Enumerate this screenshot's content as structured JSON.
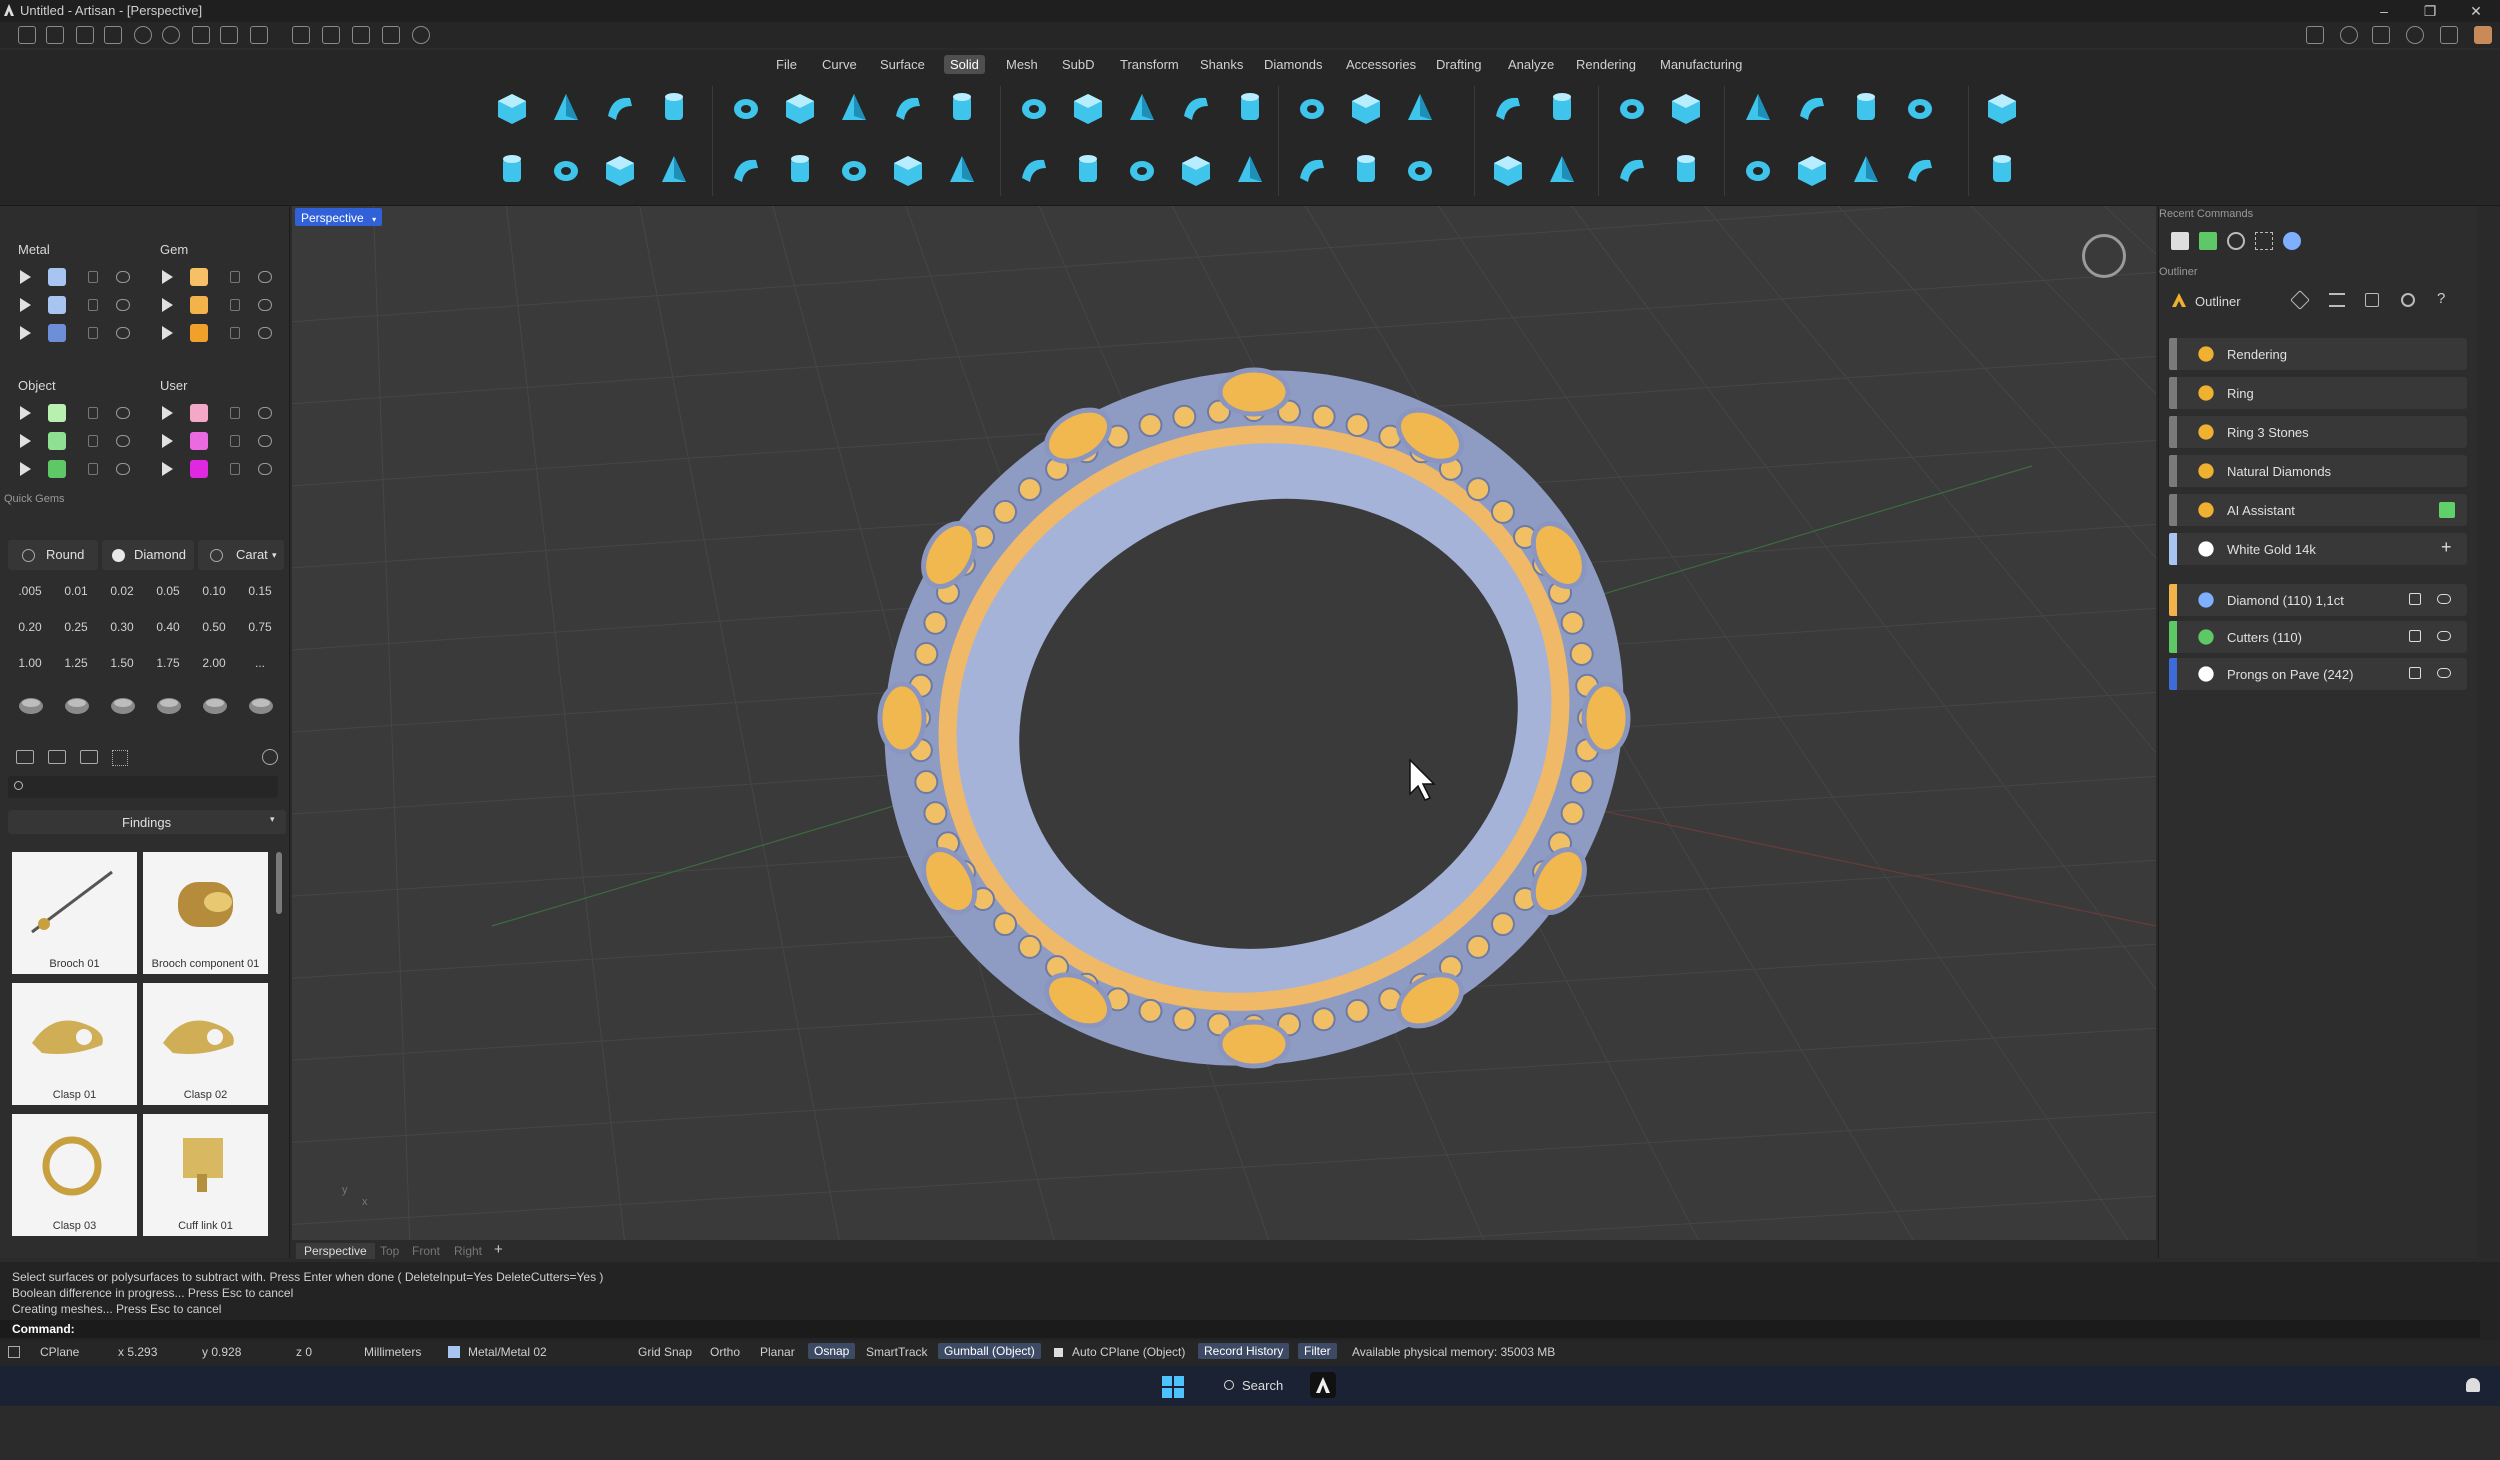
{
  "window": {
    "title": "Untitled - Artisan - [Perspective]",
    "controls": [
      "–",
      "❐",
      "✕"
    ]
  },
  "menu": {
    "items": [
      "File",
      "Curve",
      "Surface",
      "Solid",
      "Mesh",
      "SubD",
      "Transform",
      "Shanks",
      "Diamonds",
      "Accessories",
      "Drafting",
      "Analyze",
      "Rendering",
      "Manufacturing"
    ],
    "active": "Solid"
  },
  "layers": {
    "metal_title": "Metal",
    "gem_title": "Gem",
    "object_title": "Object",
    "user_title": "User",
    "metal_colors": [
      "#a8c4f0",
      "#a8c4f0",
      "#6d8fd8"
    ],
    "gem_colors": [
      "#f6c066",
      "#f3b24a",
      "#efa12c"
    ],
    "object_colors": [
      "#b8f0b0",
      "#8fe090",
      "#5ec866"
    ],
    "user_colors": [
      "#f4a8c8",
      "#ec6ae0",
      "#e028e0"
    ]
  },
  "quick_gems": {
    "title": "Quick Gems",
    "shape_label": "Round",
    "material_label": "Diamond",
    "unit_label": "Carat",
    "carats": [
      ".005",
      "0.01",
      "0.02",
      "0.05",
      "0.10",
      "0.15",
      "0.20",
      "0.25",
      "0.30",
      "0.40",
      "0.50",
      "0.75",
      "1.00",
      "1.25",
      "1.50",
      "1.75",
      "2.00",
      "..."
    ]
  },
  "library": {
    "search_placeholder": "",
    "category": "Findings",
    "items": [
      {
        "label": "Brooch 01"
      },
      {
        "label": "Brooch component 01"
      },
      {
        "label": "Clasp 01"
      },
      {
        "label": "Clasp 02"
      },
      {
        "label": "Clasp 03"
      },
      {
        "label": "Cuff link 01"
      }
    ]
  },
  "viewport": {
    "label": "Perspective",
    "tabs": [
      "Perspective",
      "Top",
      "Front",
      "Right"
    ],
    "axis_x": "x",
    "axis_y": "y"
  },
  "recent_commands": {
    "title": "Recent Commands"
  },
  "outliner": {
    "panel_title": "Outliner",
    "header": "Outliner",
    "items": [
      {
        "label": "Rendering",
        "bar": "#7a7a7a"
      },
      {
        "label": "Ring",
        "bar": "#7a7a7a"
      },
      {
        "label": "Ring 3 Stones",
        "bar": "#7a7a7a"
      },
      {
        "label": "Natural Diamonds",
        "bar": "#7a7a7a"
      },
      {
        "label": "AI Assistant",
        "bar": "#7a7a7a"
      },
      {
        "label": "White Gold 14k",
        "bar": "#a8c4f0"
      },
      {
        "label": "Diamond (110) 1,1ct",
        "bar": "#f3b24a"
      },
      {
        "label": "Cutters (110)",
        "bar": "#5ec866"
      },
      {
        "label": "Prongs on Pave (242)",
        "bar": "#3d6cd8"
      }
    ]
  },
  "command": {
    "history": [
      "Select surfaces or polysurfaces to subtract with. Press Enter when done ( DeleteInput=Yes  DeleteCutters=Yes )",
      "Boolean difference in progress... Press Esc to cancel",
      "Creating meshes... Press Esc to cancel"
    ],
    "prompt": "Command:"
  },
  "status": {
    "cplane": "CPlane",
    "x": "x 5.293",
    "y": "y 0.928",
    "z": "z 0",
    "units": "Millimeters",
    "layer": "Metal/Metal 02",
    "grid_snap": "Grid Snap",
    "ortho": "Ortho",
    "planar": "Planar",
    "osnap": "Osnap",
    "smarttrack": "SmartTrack",
    "gumball": "Gumball (Object)",
    "auto_cplane": "Auto CPlane (Object)",
    "record_history": "Record History",
    "filter": "Filter",
    "memory": "Available physical memory: 35003 MB"
  },
  "taskbar": {
    "search": "Search"
  }
}
